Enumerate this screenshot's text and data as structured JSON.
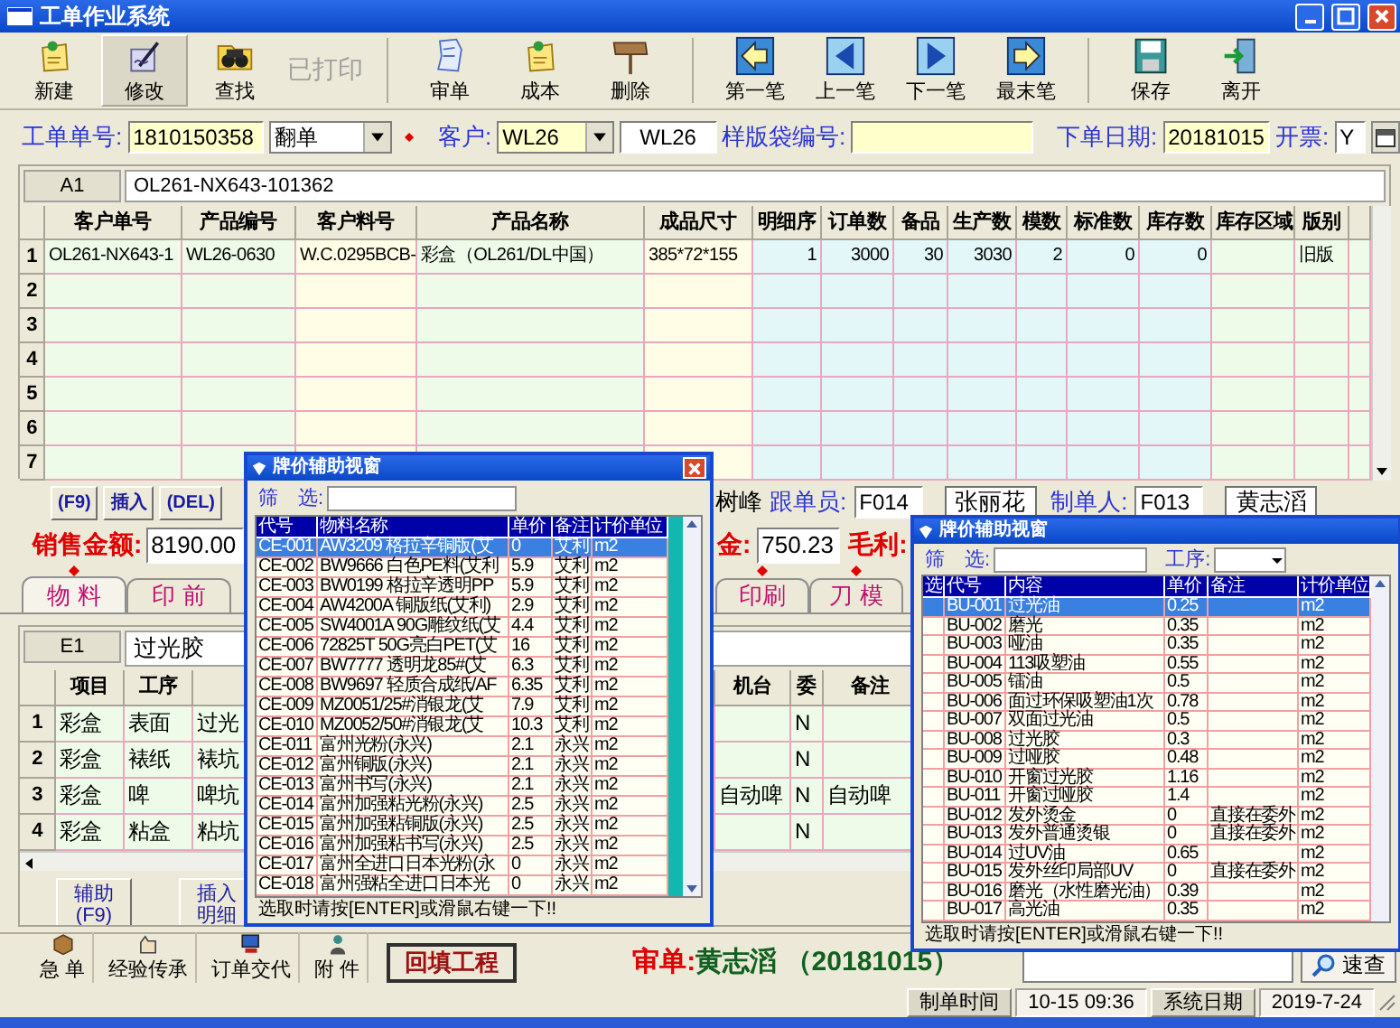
{
  "window": {
    "title": "工单作业系统"
  },
  "toolbar": [
    {
      "label": "新建",
      "kind": "note",
      "selected": false,
      "disabled": false
    },
    {
      "label": "修改",
      "kind": "pen",
      "selected": true,
      "disabled": false
    },
    {
      "label": "查找",
      "kind": "binoculars",
      "selected": false,
      "disabled": false
    },
    {
      "label": "已打印",
      "kind": "none",
      "selected": false,
      "disabled": true
    },
    {
      "label": "审单",
      "kind": "paper",
      "selected": false,
      "disabled": false
    },
    {
      "label": "成本",
      "kind": "note",
      "selected": false,
      "disabled": false
    },
    {
      "label": "删除",
      "kind": "sign",
      "selected": false,
      "disabled": false
    },
    {
      "label": "第一笔",
      "kind": "first",
      "selected": false,
      "disabled": false
    },
    {
      "label": "上一笔",
      "kind": "prev",
      "selected": false,
      "disabled": false
    },
    {
      "label": "下一笔",
      "kind": "next",
      "selected": false,
      "disabled": false
    },
    {
      "label": "最末笔",
      "kind": "last",
      "selected": false,
      "disabled": false
    },
    {
      "label": "保存",
      "kind": "disk",
      "selected": false,
      "disabled": false
    },
    {
      "label": "离开",
      "kind": "door",
      "selected": false,
      "disabled": false
    }
  ],
  "order_form": {
    "order_no_label": "工单单号:",
    "order_no": "1810150358",
    "order_type": "翻单",
    "customer_label": "客户:",
    "customer_code": "WL26",
    "customer_name": "WL26",
    "sample_bag_label": "样版袋编号:",
    "order_date_label": "下单日期:",
    "order_date": "20181015",
    "invoice_label": "开票:",
    "invoice": "Y"
  },
  "product_grid": {
    "cell_ref": "A1",
    "cell_value": "OL261-NX643-101362",
    "columns": [
      {
        "label": "客户单号",
        "kind": "text"
      },
      {
        "label": "产品编号",
        "kind": "text"
      },
      {
        "label": "客户料号",
        "kind": "code"
      },
      {
        "label": "产品名称",
        "kind": "text"
      },
      {
        "label": "成品尺寸",
        "kind": "code"
      },
      {
        "label": "明细序",
        "kind": "number"
      },
      {
        "label": "订单数",
        "kind": "number"
      },
      {
        "label": "备品",
        "kind": "number"
      },
      {
        "label": "生产数",
        "kind": "number"
      },
      {
        "label": "模数",
        "kind": "number"
      },
      {
        "label": "标准数",
        "kind": "number"
      },
      {
        "label": "库存数",
        "kind": "number"
      },
      {
        "label": "库存区域",
        "kind": "text"
      },
      {
        "label": "版别",
        "kind": "text"
      }
    ],
    "rows": [
      {
        "no": "1",
        "cells": [
          "OL261-NX643-1",
          "WL26-0630",
          "W.C.0295BCB-",
          "彩盒（OL261/DL中国）",
          "385*72*155",
          "1",
          "3000",
          "30",
          "3030",
          "2",
          "0",
          "0",
          null,
          "旧版"
        ]
      },
      {
        "no": "2"
      },
      {
        "no": "3"
      },
      {
        "no": "4"
      },
      {
        "no": "5"
      },
      {
        "no": "6"
      },
      {
        "no": "7"
      }
    ]
  },
  "detail_buttons": [
    "(F9)",
    "插入",
    "(DEL)"
  ],
  "staff": [
    {
      "kind": "text",
      "text": "树峰"
    },
    {
      "kind": "label",
      "text": "跟单员:"
    },
    {
      "kind": "field",
      "text": "F014"
    },
    {
      "kind": "box",
      "text": "张丽花"
    },
    {
      "kind": "label",
      "text": "制单人:"
    },
    {
      "kind": "field",
      "text": "F013"
    },
    {
      "kind": "box",
      "text": "黄志滔"
    }
  ],
  "totals": [
    {
      "kind": "sales",
      "label": "销售金额:",
      "value": "8190.00"
    },
    {
      "kind": "cost",
      "label": "金:",
      "value": "750.23"
    },
    {
      "kind": "profit",
      "label": "毛利:"
    }
  ],
  "tabs": [
    {
      "label": "物 料",
      "selected": true,
      "marked": true
    },
    {
      "label": "印 前",
      "selected": false,
      "marked": false
    },
    {
      "label": "印刷",
      "selected": false,
      "marked": true
    },
    {
      "label": "刀 模",
      "selected": false,
      "marked": true
    }
  ],
  "process_grid": {
    "cell_ref": "E1",
    "cell_value": "过光胶",
    "columns": [
      "项目",
      "工序",
      null,
      "机台",
      "委",
      "备注"
    ],
    "rows": [
      {
        "no": "1",
        "cells": [
          "彩盒",
          "表面",
          "过光",
          null,
          "N",
          null
        ]
      },
      {
        "no": "2",
        "cells": [
          "彩盒",
          "裱纸",
          "裱坑",
          null,
          "N",
          null
        ]
      },
      {
        "no": "3",
        "cells": [
          "彩盒",
          "啤",
          "啤坑",
          "自动啤",
          "N",
          "自动啤"
        ]
      },
      {
        "no": "4",
        "cells": [
          "彩盒",
          "粘盒",
          "粘坑",
          null,
          "N",
          null
        ]
      }
    ]
  },
  "grid_buttons": [
    {
      "lines": [
        "辅助",
        "(F9)"
      ]
    },
    {
      "lines": [
        "插入",
        "明细"
      ]
    }
  ],
  "actions": [
    {
      "label": "急 单",
      "kind": "package"
    },
    {
      "label": "经验传承",
      "kind": "hand"
    },
    {
      "label": "订单交代",
      "kind": "computer"
    },
    {
      "label": "附 件",
      "kind": "person"
    }
  ],
  "fill_button": "回填工程",
  "audit": {
    "label": "审单:",
    "name": "黄志滔",
    "date": "（20181015）"
  },
  "quick_search": {
    "button": "速查"
  },
  "status_bar": [
    {
      "kind": "label",
      "text": "制单时间"
    },
    {
      "kind": "value",
      "text": "10-15 09:36"
    },
    {
      "kind": "label",
      "text": "系统日期"
    },
    {
      "kind": "value",
      "text": "2019-7-24"
    }
  ],
  "material_picker": {
    "title": "牌价辅助视窗",
    "filter_label": "筛　选:",
    "columns": [
      "代号",
      "物料名称",
      "单价",
      "备注",
      "计价单位"
    ],
    "rows": [
      {
        "selected": true,
        "cells": [
          "CE-001",
          "AW3209 格拉辛铜版(艾",
          "0",
          "艾利",
          "m2"
        ]
      },
      {
        "selected": false,
        "cells": [
          "CE-002",
          "BW9666 白色PE料(艾利",
          "5.9",
          "艾利",
          "m2"
        ]
      },
      {
        "selected": false,
        "cells": [
          "CE-003",
          "BW0199 格拉辛透明PP",
          "5.9",
          "艾利",
          "m2"
        ]
      },
      {
        "selected": false,
        "cells": [
          "CE-004",
          "AW4200A 铜版纸(艾利)",
          "2.9",
          "艾利",
          "m2"
        ]
      },
      {
        "selected": false,
        "cells": [
          "CE-005",
          "SW4001A 90G雕纹纸(艾",
          "4.4",
          "艾利",
          "m2"
        ]
      },
      {
        "selected": false,
        "cells": [
          "CE-006",
          "72825T 50G亮白PET(艾",
          "16",
          "艾利",
          "m2"
        ]
      },
      {
        "selected": false,
        "cells": [
          "CE-007",
          "BW7777 透明龙85#(艾",
          "6.3",
          "艾利",
          "m2"
        ]
      },
      {
        "selected": false,
        "cells": [
          "CE-008",
          "BW9697 轻质合成纸/AF",
          "6.35",
          "艾利",
          "m2"
        ]
      },
      {
        "selected": false,
        "cells": [
          "CE-009",
          "MZ0051/25#消银龙(艾",
          "7.9",
          "艾利",
          "m2"
        ]
      },
      {
        "selected": false,
        "cells": [
          "CE-010",
          "MZ0052/50#消银龙(艾",
          "10.3",
          "艾利",
          "m2"
        ]
      },
      {
        "selected": false,
        "cells": [
          "CE-011",
          "富州光粉(永兴)",
          "2.1",
          "永兴",
          "m2"
        ]
      },
      {
        "selected": false,
        "cells": [
          "CE-012",
          "富州铜版(永兴)",
          "2.1",
          "永兴",
          "m2"
        ]
      },
      {
        "selected": false,
        "cells": [
          "CE-013",
          "富州书写(永兴)",
          "2.1",
          "永兴",
          "m2"
        ]
      },
      {
        "selected": false,
        "cells": [
          "CE-014",
          "富州加强粘光粉(永兴)",
          "2.5",
          "永兴",
          "m2"
        ]
      },
      {
        "selected": false,
        "cells": [
          "CE-015",
          "富州加强粘铜版(永兴)",
          "2.5",
          "永兴",
          "m2"
        ]
      },
      {
        "selected": false,
        "cells": [
          "CE-016",
          "富州加强粘书写(永兴)",
          "2.5",
          "永兴",
          "m2"
        ]
      },
      {
        "selected": false,
        "cells": [
          "CE-017",
          "富州全进口日本光粉(永",
          "0",
          "永兴",
          "m2"
        ]
      },
      {
        "selected": false,
        "cells": [
          "CE-018",
          "富州强粘全进口日本光",
          "0",
          "永兴",
          "m2"
        ]
      }
    ],
    "hint": "选取时请按[ENTER]或滑鼠右键一下!!"
  },
  "process_picker": {
    "title": "牌价辅助视窗",
    "filter_label": "筛　选:",
    "process_label": "工序:",
    "columns": [
      "选",
      "代号",
      "内容",
      "单价",
      "备注",
      "计价单位"
    ],
    "rows": [
      {
        "selected": true,
        "cells": [
          null,
          "BU-001",
          "过光油",
          "0.25",
          null,
          "m2"
        ]
      },
      {
        "selected": false,
        "cells": [
          null,
          "BU-002",
          "磨光",
          "0.35",
          null,
          "m2"
        ]
      },
      {
        "selected": false,
        "cells": [
          null,
          "BU-003",
          "哑油",
          "0.35",
          null,
          "m2"
        ]
      },
      {
        "selected": false,
        "cells": [
          null,
          "BU-004",
          "113吸塑油",
          "0.55",
          null,
          "m2"
        ]
      },
      {
        "selected": false,
        "cells": [
          null,
          "BU-005",
          "镭油",
          "0.5",
          null,
          "m2"
        ]
      },
      {
        "selected": false,
        "cells": [
          null,
          "BU-006",
          "面过环保吸塑油1次",
          "0.78",
          null,
          "m2"
        ]
      },
      {
        "selected": false,
        "cells": [
          null,
          "BU-007",
          "双面过光油",
          "0.5",
          null,
          "m2"
        ]
      },
      {
        "selected": false,
        "cells": [
          null,
          "BU-008",
          "过光胶",
          "0.3",
          null,
          "m2"
        ]
      },
      {
        "selected": false,
        "cells": [
          null,
          "BU-009",
          "过哑胶",
          "0.48",
          null,
          "m2"
        ]
      },
      {
        "selected": false,
        "cells": [
          null,
          "BU-010",
          "开窗过光胶",
          "1.16",
          null,
          "m2"
        ]
      },
      {
        "selected": false,
        "cells": [
          null,
          "BU-011",
          "开窗过哑胶",
          "1.4",
          null,
          "m2"
        ]
      },
      {
        "selected": false,
        "cells": [
          null,
          "BU-012",
          "发外烫金",
          "0",
          "直接在委外",
          "m2"
        ]
      },
      {
        "selected": false,
        "cells": [
          null,
          "BU-013",
          "发外普通烫银",
          "0",
          "直接在委外",
          "m2"
        ]
      },
      {
        "selected": false,
        "cells": [
          null,
          "BU-014",
          "过UV油",
          "0.65",
          null,
          "m2"
        ]
      },
      {
        "selected": false,
        "cells": [
          null,
          "BU-015",
          "发外丝印局部UV",
          "0",
          "直接在委外",
          "m2"
        ]
      },
      {
        "selected": false,
        "cells": [
          null,
          "BU-016",
          "磨光（水性磨光油）",
          "0.39",
          null,
          "m2"
        ]
      },
      {
        "selected": false,
        "cells": [
          null,
          "BU-017",
          "高光油",
          "0.35",
          null,
          "m2"
        ]
      }
    ],
    "hint": "选取时请按[ENTER]或滑鼠右键一下!!"
  }
}
